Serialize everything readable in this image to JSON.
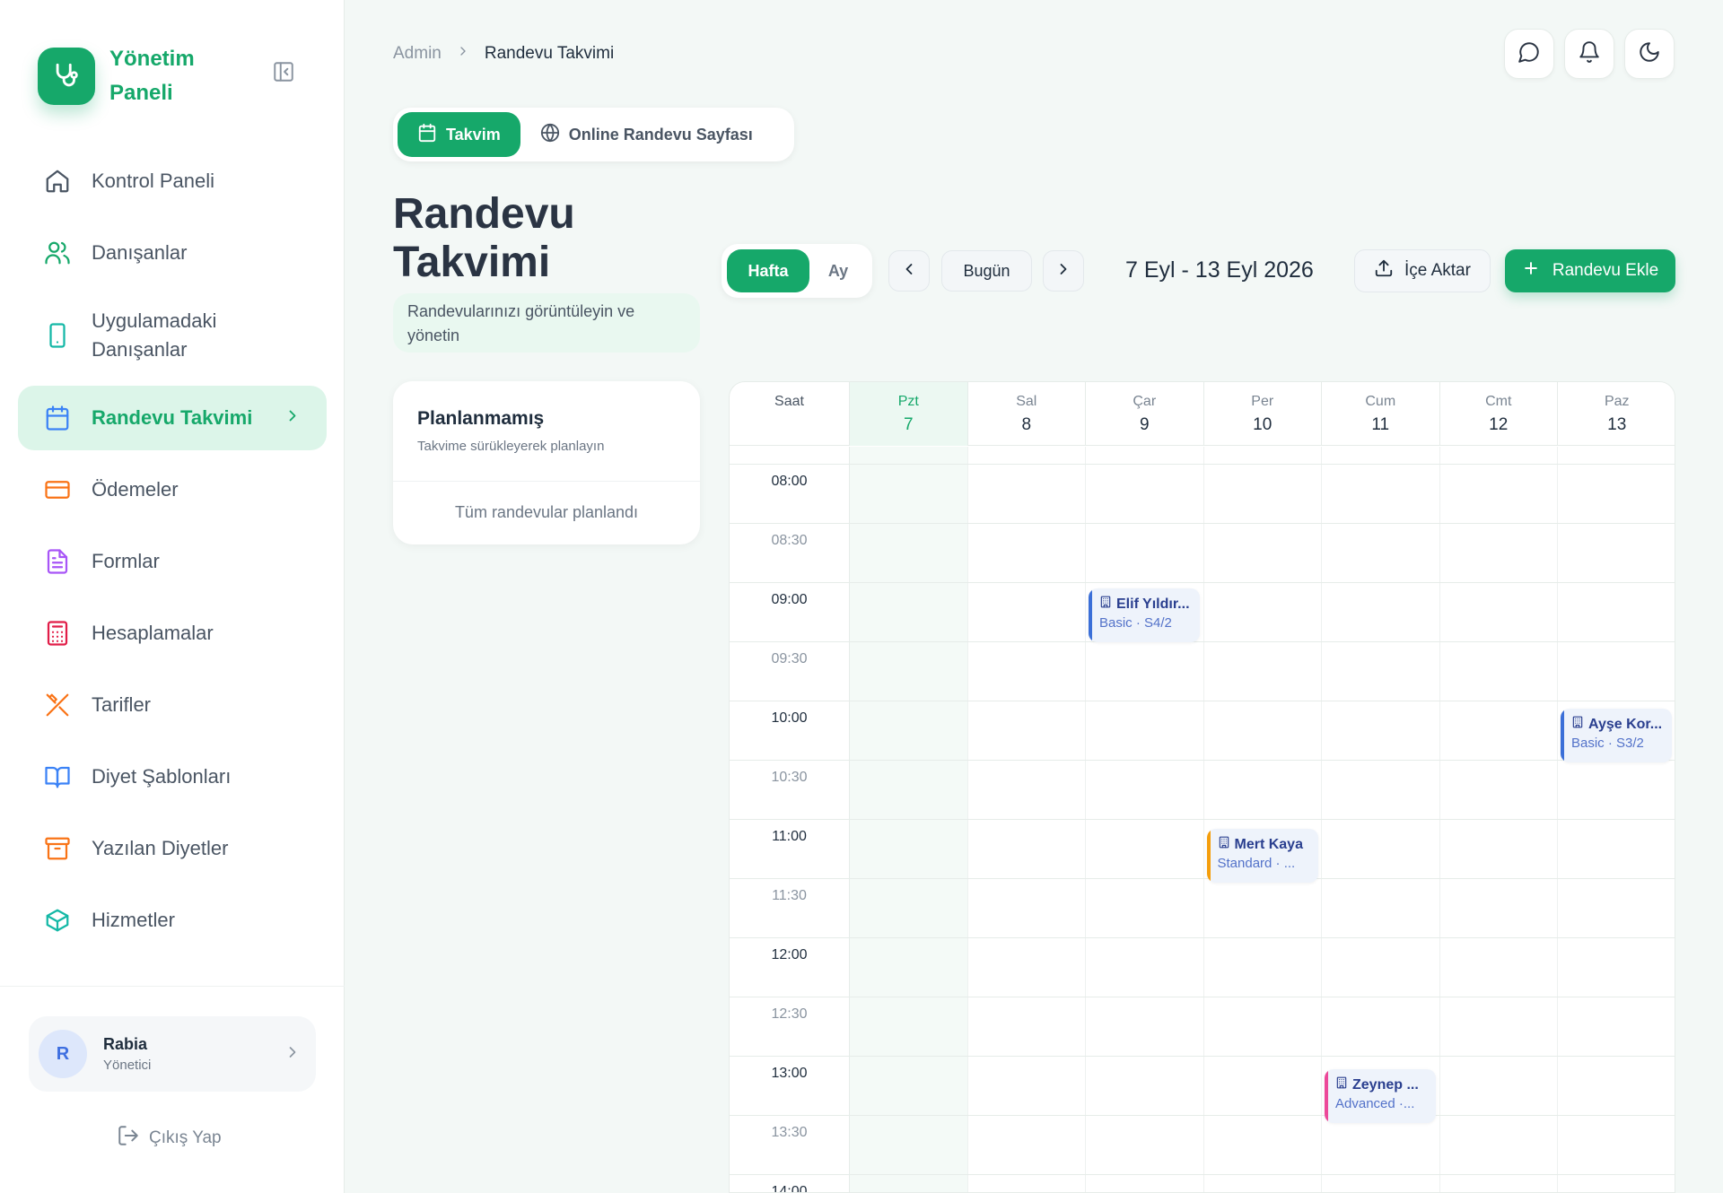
{
  "sidebar": {
    "brand": "Yönetim Paneli",
    "items": [
      {
        "label": "Kontrol Paneli",
        "icon": "home-icon",
        "color": "#4a5563"
      },
      {
        "label": "Danışanlar",
        "icon": "users-icon",
        "color": "#16a86a"
      },
      {
        "label": "Uygulamadaki Danışanlar",
        "icon": "smartphone-icon",
        "color": "#14b8a6"
      },
      {
        "label": "Randevu Takvimi",
        "icon": "calendar-icon",
        "color": "#3b82f6",
        "active": true
      },
      {
        "label": "Ödemeler",
        "icon": "credit-card-icon",
        "color": "#f97316"
      },
      {
        "label": "Formlar",
        "icon": "file-text-icon",
        "color": "#a855f7"
      },
      {
        "label": "Hesaplamalar",
        "icon": "calculator-icon",
        "color": "#e11d48"
      },
      {
        "label": "Tarifler",
        "icon": "utensils-icon",
        "color": "#f97316"
      },
      {
        "label": "Diyet Şablonları",
        "icon": "book-open-icon",
        "color": "#3b82f6"
      },
      {
        "label": "Yazılan Diyetler",
        "icon": "archive-icon",
        "color": "#f97316"
      },
      {
        "label": "Hizmetler",
        "icon": "package-icon",
        "color": "#14b8a6"
      }
    ],
    "user": {
      "initial": "R",
      "name": "Rabia",
      "role": "Yönetici"
    },
    "logout": "Çıkış Yap"
  },
  "breadcrumb": {
    "root": "Admin",
    "current": "Randevu Takvimi"
  },
  "tabs": {
    "calendar": "Takvim",
    "online": "Online Randevu Sayfası"
  },
  "page": {
    "title": "Randevu Takvimi",
    "subtitle": "Randevularınızı görüntüleyin ve yönetin"
  },
  "toolbar": {
    "week": "Hafta",
    "month": "Ay",
    "today": "Bugün",
    "range": "7 Eyl - 13 Eyl 2026",
    "import": "İçe Aktar",
    "add": "Randevu Ekle"
  },
  "unplanned": {
    "title": "Planlanmamış",
    "subtitle": "Takvime sürükleyerek planlayın",
    "empty": "Tüm randevular planlandı"
  },
  "calendar": {
    "time_header": "Saat",
    "days": [
      {
        "name": "Pzt",
        "date": "7",
        "today": true
      },
      {
        "name": "Sal",
        "date": "8"
      },
      {
        "name": "Çar",
        "date": "9"
      },
      {
        "name": "Per",
        "date": "10"
      },
      {
        "name": "Cum",
        "date": "11"
      },
      {
        "name": "Cmt",
        "date": "12"
      },
      {
        "name": "Paz",
        "date": "13"
      }
    ],
    "times": [
      "08:00",
      "08:30",
      "09:00",
      "09:30",
      "10:00",
      "10:30",
      "11:00",
      "11:30",
      "12:00",
      "12:30",
      "13:00",
      "13:30",
      "14:00"
    ],
    "events": [
      {
        "name": "Elif Yıldır...",
        "package": "Basic · S4/2",
        "day": 2,
        "slot": 2,
        "accent": "#3b6fd8"
      },
      {
        "name": "Ayşe Kor...",
        "package": "Basic · S3/2",
        "day": 6,
        "slot": 4,
        "accent": "#3b6fd8"
      },
      {
        "name": "Mert Kaya",
        "package": "Standard · ...",
        "day": 3,
        "slot": 6,
        "accent": "#f59e0b"
      },
      {
        "name": "Zeynep ...",
        "package": "Advanced ·...",
        "day": 4,
        "slot": 10,
        "accent": "#ec4899"
      }
    ]
  },
  "colors": {
    "accent": "#16a86a",
    "today_bg": "#ecf8f2"
  }
}
